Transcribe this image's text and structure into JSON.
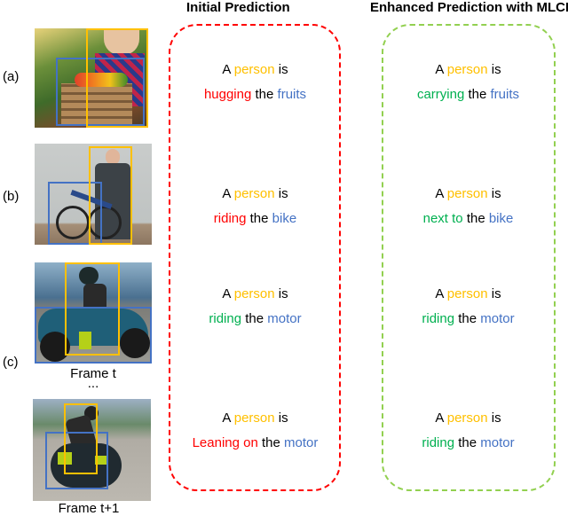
{
  "headers": {
    "initial": "Initial Prediction",
    "enhanced": "Enhanced Prediction with MLCR"
  },
  "colors": {
    "subject": "#ffc000",
    "object": "#4472c4",
    "wrong": "#ff0000",
    "correct": "#00b050",
    "initial_box": "#ff0000",
    "enhanced_box": "#92d050"
  },
  "rows": [
    {
      "label": "(a)",
      "image": "person holding crate of vegetables",
      "initial": {
        "a": "A",
        "subject": "person",
        "is": "is",
        "predicate": "hugging",
        "the": "the",
        "object": "fruits",
        "status": "wrong"
      },
      "enhanced": {
        "a": "A",
        "subject": "person",
        "is": "is",
        "predicate": "carrying",
        "the": "the",
        "object": "fruits",
        "status": "correct"
      }
    },
    {
      "label": "(b)",
      "image": "man in suit standing next to bicycle",
      "initial": {
        "a": "A",
        "subject": "person",
        "is": "is",
        "predicate": "riding",
        "the": "the",
        "object": "bike",
        "status": "wrong"
      },
      "enhanced": {
        "a": "A",
        "subject": "person",
        "is": "is",
        "predicate": "next to",
        "the": "the",
        "object": "bike",
        "status": "correct"
      }
    },
    {
      "label": "(c)",
      "image": "rider on motorcycle",
      "caption": "Frame t",
      "ellipsis": "...",
      "initial": {
        "a": "A",
        "subject": "person",
        "is": "is",
        "predicate": "riding",
        "the": "the",
        "object": "motor",
        "status": "correct"
      },
      "enhanced": {
        "a": "A",
        "subject": "person",
        "is": "is",
        "predicate": "riding",
        "the": "the",
        "object": "motor",
        "status": "correct"
      }
    },
    {
      "label": "",
      "image": "rider leaning motorcycle in turn",
      "caption": "Frame t+1",
      "initial": {
        "a": "A",
        "subject": "person",
        "is": "is",
        "predicate": "Leaning on",
        "the": "the",
        "object": "motor",
        "status": "wrong"
      },
      "enhanced": {
        "a": "A",
        "subject": "person",
        "is": "is",
        "predicate": "riding",
        "the": "the",
        "object": "motor",
        "status": "correct"
      }
    }
  ]
}
